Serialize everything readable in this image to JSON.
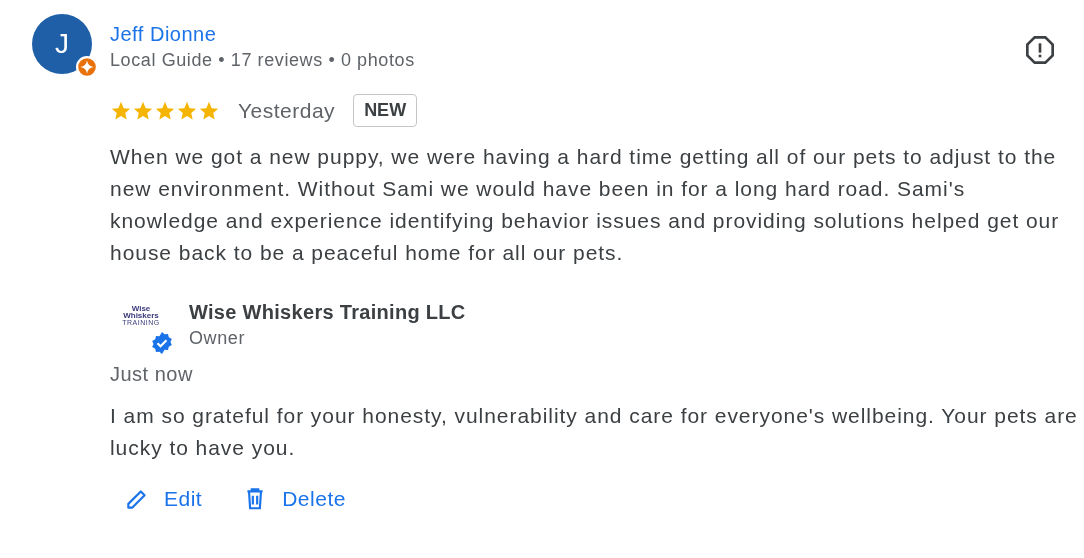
{
  "reviewer": {
    "initial": "J",
    "name": "Jeff Dionne",
    "local_guide": true,
    "meta": "Local Guide • 17 reviews • 0 photos"
  },
  "review": {
    "stars": 5,
    "date": "Yesterday",
    "badge": "NEW",
    "text": "When we got a new puppy, we were having a hard time getting all of our pets to adjust to the new environment. Without Sami we would have been in for a long hard road. Sami's knowledge and experience identifying behavior issues and providing solutions helped get our house back to be a peaceful home for all our pets."
  },
  "reply": {
    "logo_lines": [
      "Wise",
      "Whiskers",
      "TRAINING"
    ],
    "verified": true,
    "name": "Wise Whiskers Training LLC",
    "role": "Owner",
    "date": "Just now",
    "text": "I am so grateful for your honesty, vulnerability and care for everyone's wellbeing. Your pets are lucky to have you."
  },
  "actions": [
    {
      "kind": "edit",
      "label": "Edit"
    },
    {
      "kind": "delete",
      "label": "Delete"
    }
  ]
}
